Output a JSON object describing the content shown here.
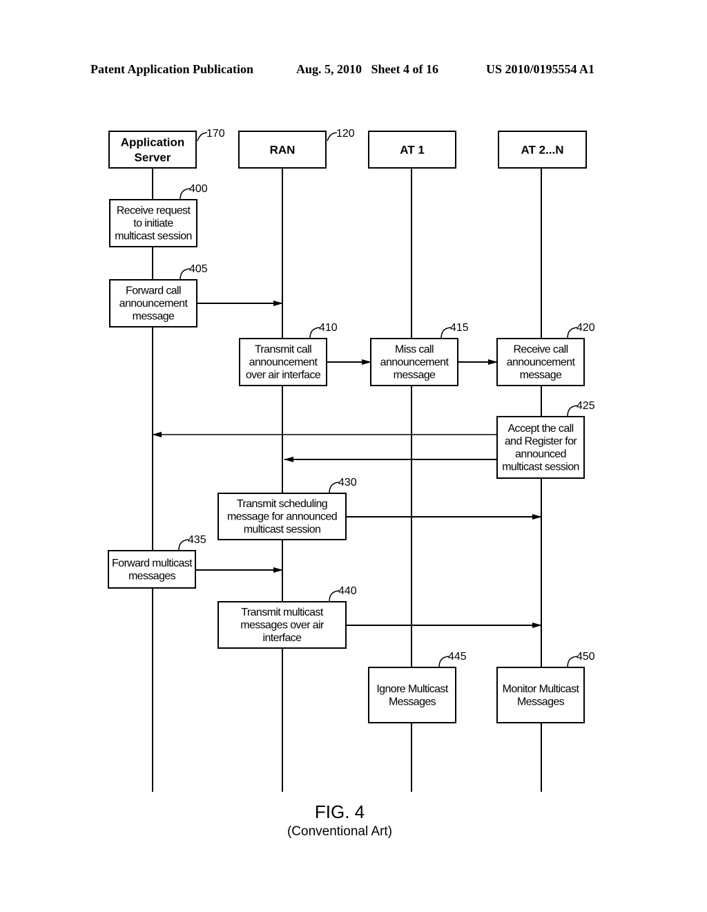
{
  "header": {
    "left": "Patent Application Publication",
    "date": "Aug. 5, 2010",
    "sheet": "Sheet 4 of 16",
    "number": "US 2010/0195554 A1"
  },
  "actors": [
    {
      "id": "app-server",
      "lines": [
        "Application",
        "Server"
      ],
      "ref": "170"
    },
    {
      "id": "ran",
      "lines": [
        "RAN"
      ],
      "ref": "120"
    },
    {
      "id": "at1",
      "lines": [
        "AT 1"
      ],
      "ref": ""
    },
    {
      "id": "at2n",
      "lines": [
        "AT 2...N"
      ],
      "ref": ""
    }
  ],
  "steps": [
    {
      "ref": "400",
      "actor": "app-server",
      "lines": [
        "Receive request",
        "to initiate",
        "multicast session"
      ]
    },
    {
      "ref": "405",
      "actor": "app-server",
      "lines": [
        "Forward call",
        "announcement",
        "message"
      ]
    },
    {
      "ref": "410",
      "actor": "ran",
      "lines": [
        "Transmit call",
        "announcement",
        "over air interface"
      ]
    },
    {
      "ref": "415",
      "actor": "at1",
      "lines": [
        "Miss call",
        "announcement",
        "message"
      ]
    },
    {
      "ref": "420",
      "actor": "at2n",
      "lines": [
        "Receive call",
        "announcement",
        "message"
      ]
    },
    {
      "ref": "425",
      "actor": "at2n",
      "lines": [
        "Accept the call",
        "and Register for",
        "announced",
        "multicast session"
      ]
    },
    {
      "ref": "430",
      "actor": "ran",
      "lines": [
        "Transmit scheduling",
        "message for announced",
        "multicast session"
      ]
    },
    {
      "ref": "435",
      "actor": "app-server",
      "lines": [
        "Forward multicast",
        "messages"
      ]
    },
    {
      "ref": "440",
      "actor": "ran",
      "lines": [
        "Transmit multicast",
        "messages over air",
        "interface"
      ]
    },
    {
      "ref": "445",
      "actor": "at1",
      "lines": [
        "Ignore Multicast",
        "Messages"
      ]
    },
    {
      "ref": "450",
      "actor": "at2n",
      "lines": [
        "Monitor Multicast",
        "Messages"
      ]
    }
  ],
  "messages": [
    {
      "from": "405",
      "to": "ran"
    },
    {
      "from": "410",
      "to": "415"
    },
    {
      "from": "415",
      "to": "420"
    },
    {
      "from": "425",
      "to": "app-server"
    },
    {
      "from": "425",
      "to": "ran"
    },
    {
      "from": "430",
      "to": "at2n"
    },
    {
      "from": "435",
      "to": "ran"
    },
    {
      "from": "440",
      "to": "at2n"
    }
  ],
  "figure": {
    "title": "FIG. 4",
    "subtitle": "(Conventional Art)"
  }
}
